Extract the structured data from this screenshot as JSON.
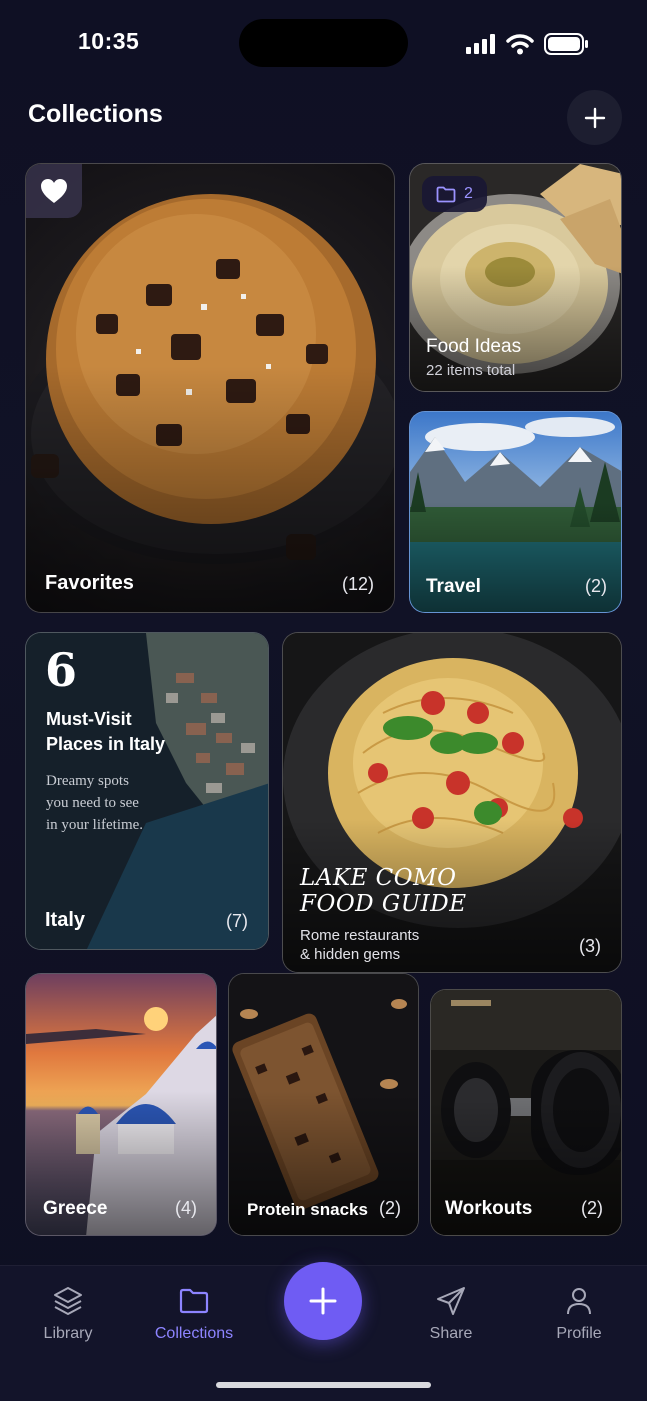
{
  "status": {
    "time": "10:35"
  },
  "header": {
    "title": "Collections"
  },
  "cards": {
    "favorites": {
      "label": "Favorites",
      "count": "(12)"
    },
    "food": {
      "label": "Food Ideas",
      "sub": "22 items total",
      "badge": "2"
    },
    "travel": {
      "label": "Travel",
      "count": "(2)"
    },
    "italy": {
      "big_number": "6",
      "headline_1": "Must-Visit",
      "headline_2": "Places in Italy",
      "desc_1": "Dreamy spots",
      "desc_2": "you need to see",
      "desc_3": "in your lifetime.",
      "label": "Italy",
      "count": "(7)"
    },
    "como": {
      "headline_1": "LAKE COMO",
      "headline_2": "FOOD GUIDE",
      "sub_1": "Rome restaurants",
      "sub_2": "& hidden gems",
      "count": "(3)"
    },
    "greece": {
      "label": "Greece",
      "count": "(4)"
    },
    "protein": {
      "label": "Protein snacks",
      "count": "(2)"
    },
    "workouts": {
      "label": "Workouts",
      "count": "(2)"
    }
  },
  "nav": {
    "library": "Library",
    "collections": "Collections",
    "share": "Share",
    "profile": "Profile"
  },
  "colors": {
    "accent": "#6f5cf3",
    "active_nav": "#8d84ff",
    "background": "#0f1024"
  }
}
